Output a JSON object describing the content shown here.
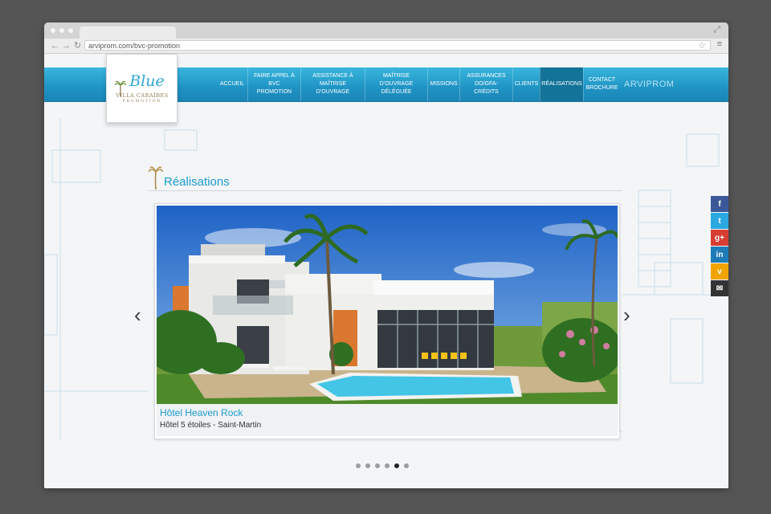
{
  "browser": {
    "url": "arviprom.com/bvc-promotion"
  },
  "logo": {
    "word": "Blue",
    "line1": "VILLA CARAÏBES",
    "line2": "PROMOTION"
  },
  "nav": {
    "items": [
      {
        "label": "ACCUEIL"
      },
      {
        "label": "FAIRE APPEL À BVC PROMOTION"
      },
      {
        "label": "ASSISTANCE À MAÎTRISE D'OUVRAGE"
      },
      {
        "label": "MAÎTRISE D'OUVRAGE DÉLÉGUÉE"
      },
      {
        "label": "MISSIONS"
      },
      {
        "label": "ASSURANCES DO/GFA-CRÉDITS"
      },
      {
        "label": "CLIENTS"
      },
      {
        "label": "RÉALISATIONS"
      },
      {
        "label": "CONTACT BROCHURE"
      }
    ],
    "active_index": 7,
    "brand": "ARVIPROM"
  },
  "section": {
    "title": "Réalisations"
  },
  "slider": {
    "title": "Hôtel Heaven Rock",
    "subtitle": "Hôtel 5 étoiles - Saint-Martin",
    "prev": "‹",
    "next": "›",
    "slide_count": 6,
    "current_slide": 5
  },
  "social": [
    {
      "name": "facebook-icon",
      "glyph": "f",
      "color": "#3b5998"
    },
    {
      "name": "twitter-icon",
      "glyph": "t",
      "color": "#2aa9e0"
    },
    {
      "name": "google-plus-icon",
      "glyph": "g+",
      "color": "#d73d32"
    },
    {
      "name": "linkedin-icon",
      "glyph": "in",
      "color": "#1e7bb7"
    },
    {
      "name": "viadeo-icon",
      "glyph": "v",
      "color": "#f0a400"
    },
    {
      "name": "email-icon",
      "glyph": "✉",
      "color": "#333333"
    }
  ],
  "colors": {
    "header": "#1f93c4",
    "accent": "#1a9bd1",
    "active": "#137399"
  }
}
